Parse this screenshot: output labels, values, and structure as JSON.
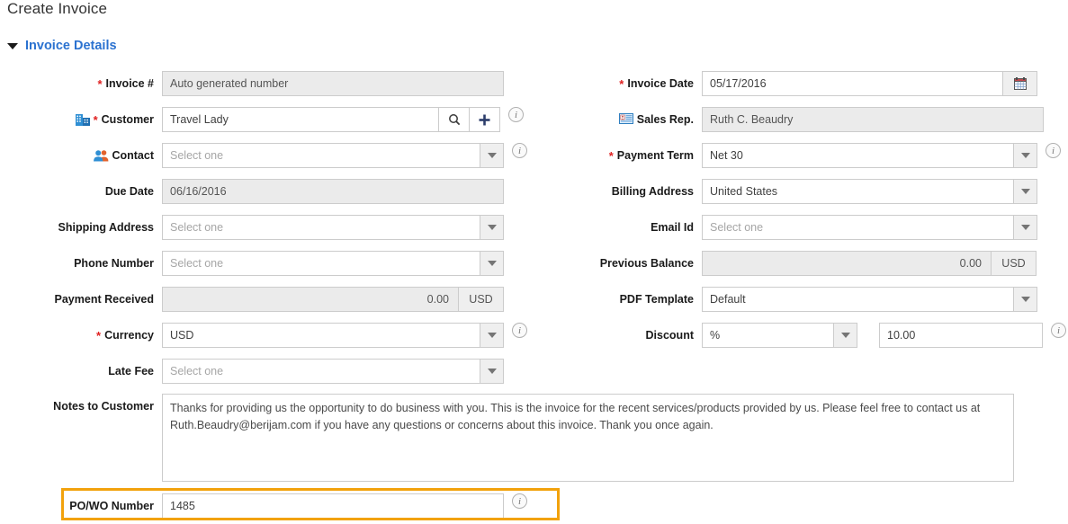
{
  "page": {
    "title": "Create Invoice",
    "section_title": "Invoice Details",
    "chevron_icon": "chevron-down-icon",
    "highlight_color": "#f2a20c",
    "accent_color": "#2b72d0"
  },
  "fields": {
    "invoice_number": {
      "label": "Invoice #",
      "required": true,
      "value": "Auto generated number",
      "readonly": true
    },
    "invoice_date": {
      "label": "Invoice Date",
      "required": true,
      "value": "05/17/2016",
      "button_icon": "calendar-icon"
    },
    "customer": {
      "label": "Customer",
      "required": true,
      "value": "Travel Lady",
      "label_icon": "building-icon",
      "search_icon": "search-icon",
      "add_icon": "plus-icon",
      "info_icon": "info-icon"
    },
    "sales_rep": {
      "label": "Sales Rep.",
      "value": "Ruth C. Beaudry",
      "readonly": true,
      "label_icon": "id-card-icon"
    },
    "contact": {
      "label": "Contact",
      "placeholder": "Select one",
      "label_icon": "contacts-icon",
      "info_icon": "info-icon",
      "dropdown_icon": "chevron-down-icon"
    },
    "payment_term": {
      "label": "Payment Term",
      "required": true,
      "value": "Net 30",
      "info_icon": "info-icon",
      "dropdown_icon": "chevron-down-icon"
    },
    "due_date": {
      "label": "Due Date",
      "value": "06/16/2016",
      "readonly": true
    },
    "billing_address": {
      "label": "Billing Address",
      "value": "United States",
      "dropdown_icon": "chevron-down-icon"
    },
    "shipping_address": {
      "label": "Shipping Address",
      "placeholder": "Select one",
      "dropdown_icon": "chevron-down-icon"
    },
    "email_id": {
      "label": "Email Id",
      "placeholder": "Select one",
      "dropdown_icon": "chevron-down-icon"
    },
    "phone_number": {
      "label": "Phone Number",
      "placeholder": "Select one",
      "dropdown_icon": "chevron-down-icon"
    },
    "previous_balance": {
      "label": "Previous Balance",
      "value": "0.00",
      "currency": "USD",
      "readonly": true
    },
    "payment_received": {
      "label": "Payment Received",
      "value": "0.00",
      "currency": "USD",
      "readonly": true
    },
    "pdf_template": {
      "label": "PDF Template",
      "value": "Default",
      "dropdown_icon": "chevron-down-icon"
    },
    "currency": {
      "label": "Currency",
      "required": true,
      "value": "USD",
      "info_icon": "info-icon",
      "dropdown_icon": "chevron-down-icon"
    },
    "discount": {
      "label": "Discount",
      "type_value": "%",
      "amount_value": "10.00",
      "info_icon": "info-icon",
      "dropdown_icon": "chevron-down-icon"
    },
    "late_fee": {
      "label": "Late Fee",
      "placeholder": "Select one",
      "dropdown_icon": "chevron-down-icon"
    },
    "notes_to_customer": {
      "label": "Notes to Customer",
      "value": "Thanks for providing us the opportunity to do business with you. This is the invoice for the recent services/products provided by us. Please feel free to contact us at Ruth.Beaudry@berijam.com if you have any questions or concerns about this invoice. Thank you once again."
    },
    "po_wo_number": {
      "label": "PO/WO Number",
      "value": "1485",
      "info_icon": "info-icon",
      "highlighted": true
    }
  }
}
